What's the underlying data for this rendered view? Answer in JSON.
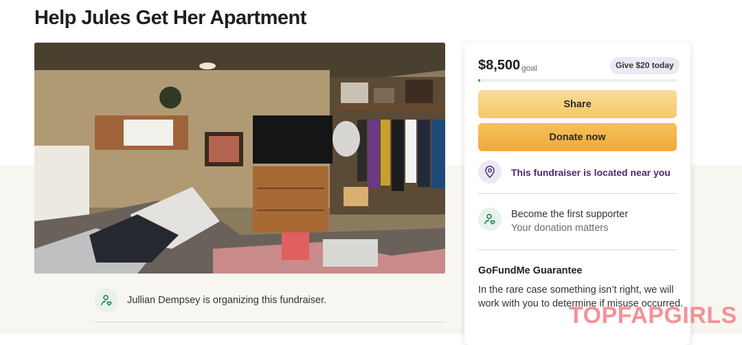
{
  "page": {
    "title": "Help Jules Get Her Apartment",
    "photo_alt": "photo-of-cluttered-apartment"
  },
  "organizer": {
    "text": "Jullian Dempsey is organizing this fundraiser.",
    "icon": "person-heart-icon"
  },
  "donation_card": {
    "amount": "$8,500",
    "goal_label": "goal",
    "give_pill": "Give $20 today",
    "progress_fraction": 0.01,
    "progress_color": "#12a454",
    "share_label": "Share",
    "donate_label": "Donate now",
    "location_text": "This fundraiser is located near you",
    "location_icon": "location-pin-icon",
    "supporter_title": "Become the first supporter",
    "supporter_subtitle": "Your donation matters",
    "supporter_icon": "person-heart-icon",
    "guarantee_title": "GoFundMe Guarantee",
    "guarantee_text": "In the rare case something isn’t right, we will work with you to determine if misuse occurred."
  },
  "watermark": {
    "text": "TOPFAPGIRLS"
  },
  "colors": {
    "accent_purple": "#4b2b6b",
    "button_share": "#f6c866",
    "button_donate": "#f0a93a",
    "watermark": "#f28a90"
  }
}
